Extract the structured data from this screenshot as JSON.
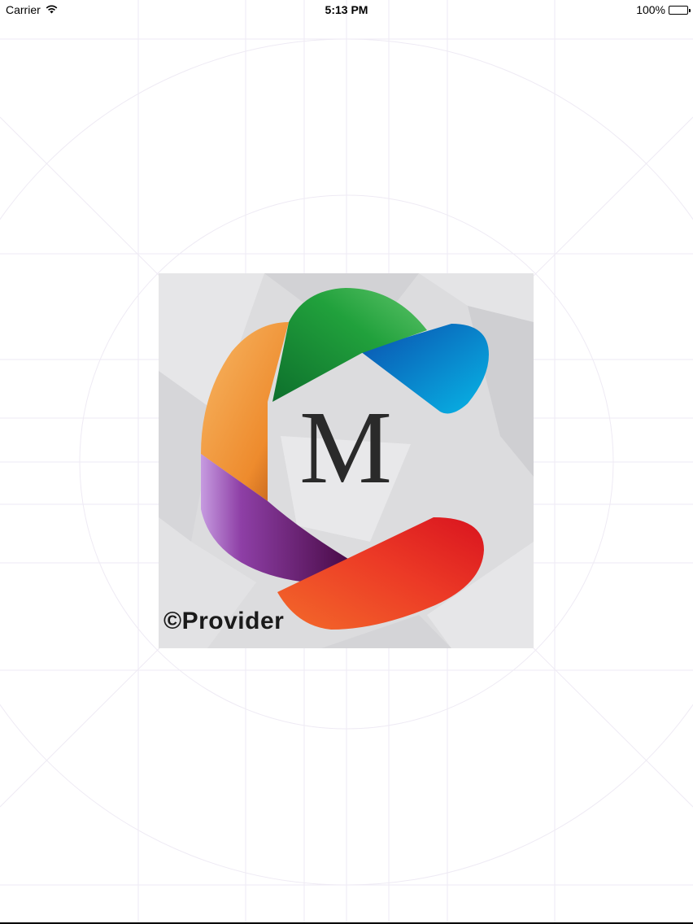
{
  "status_bar": {
    "carrier": "Carrier",
    "wifi_icon": "wifi-icon",
    "time": "5:13 PM",
    "battery_percent": "100%",
    "battery_icon": "battery-icon",
    "battery_level": 1.0
  },
  "splash": {
    "logo_letter": "M",
    "logo_caption": "©Provider",
    "colors": {
      "green": "#1f9a3a",
      "blue": "#0a7fcf",
      "orange": "#f09a3a",
      "purple": "#7a2f8c",
      "red": "#e2242b",
      "red_orange": "#f0562a",
      "tile_bg": "#dcdcde"
    }
  }
}
